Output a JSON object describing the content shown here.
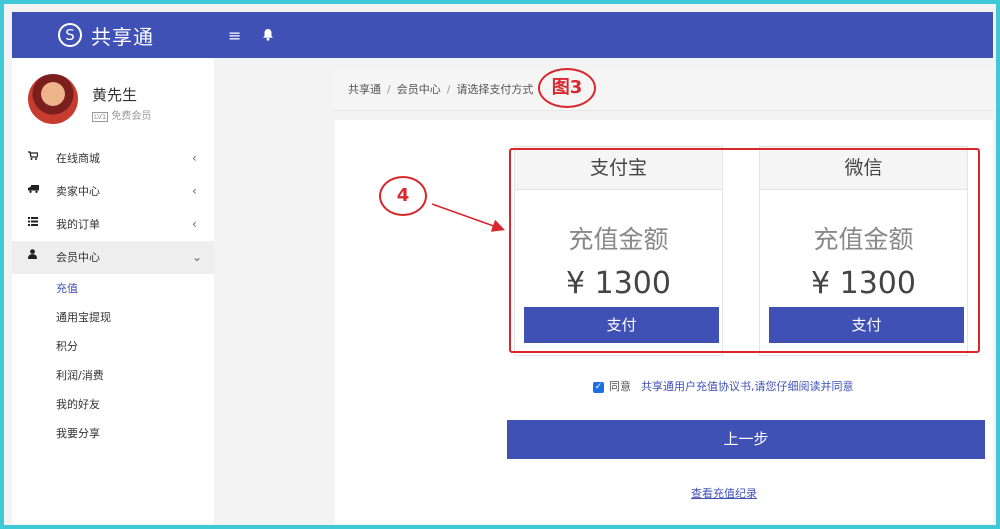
{
  "header": {
    "logo_letter": "S",
    "app_name": "共享通",
    "menu_icon": "hamburger-icon",
    "bell_icon": "bell-icon"
  },
  "user": {
    "name": "黄先生",
    "level_badge": "LV1",
    "level": "免费会员"
  },
  "sidebar": {
    "items": [
      {
        "label": "在线商城",
        "icon": "cart-icon",
        "arrow": "‹"
      },
      {
        "label": "卖家中心",
        "icon": "truck-icon",
        "arrow": "‹"
      },
      {
        "label": "我的订单",
        "icon": "list-icon",
        "arrow": "‹"
      },
      {
        "label": "会员中心",
        "icon": "user-icon",
        "arrow": "⌄"
      }
    ],
    "subitems": [
      "充值",
      "通用宝提现",
      "积分",
      "利润/消费",
      "我的好友",
      "我要分享"
    ]
  },
  "breadcrumb": [
    "共享通",
    "会员中心",
    "请选择支付方式"
  ],
  "annotations": {
    "note3": "图3",
    "note4": "4",
    "color": "#d9272e"
  },
  "payments": [
    {
      "header": "支付宝",
      "label": "充值金额",
      "amount": "¥ 1300",
      "button": "支付"
    },
    {
      "header": "微信",
      "label": "充值金额",
      "amount": "¥ 1300",
      "button": "支付"
    }
  ],
  "agreement": {
    "checked": true,
    "word": "同意",
    "link": "共享通用户充值协议书,请您仔细阅读并同意"
  },
  "prev_button": "上一步",
  "history_link": "查看充值纪录",
  "colors": {
    "primary": "#3f51b5",
    "annotation": "#d9272e",
    "frame": "#3fc9d6"
  }
}
